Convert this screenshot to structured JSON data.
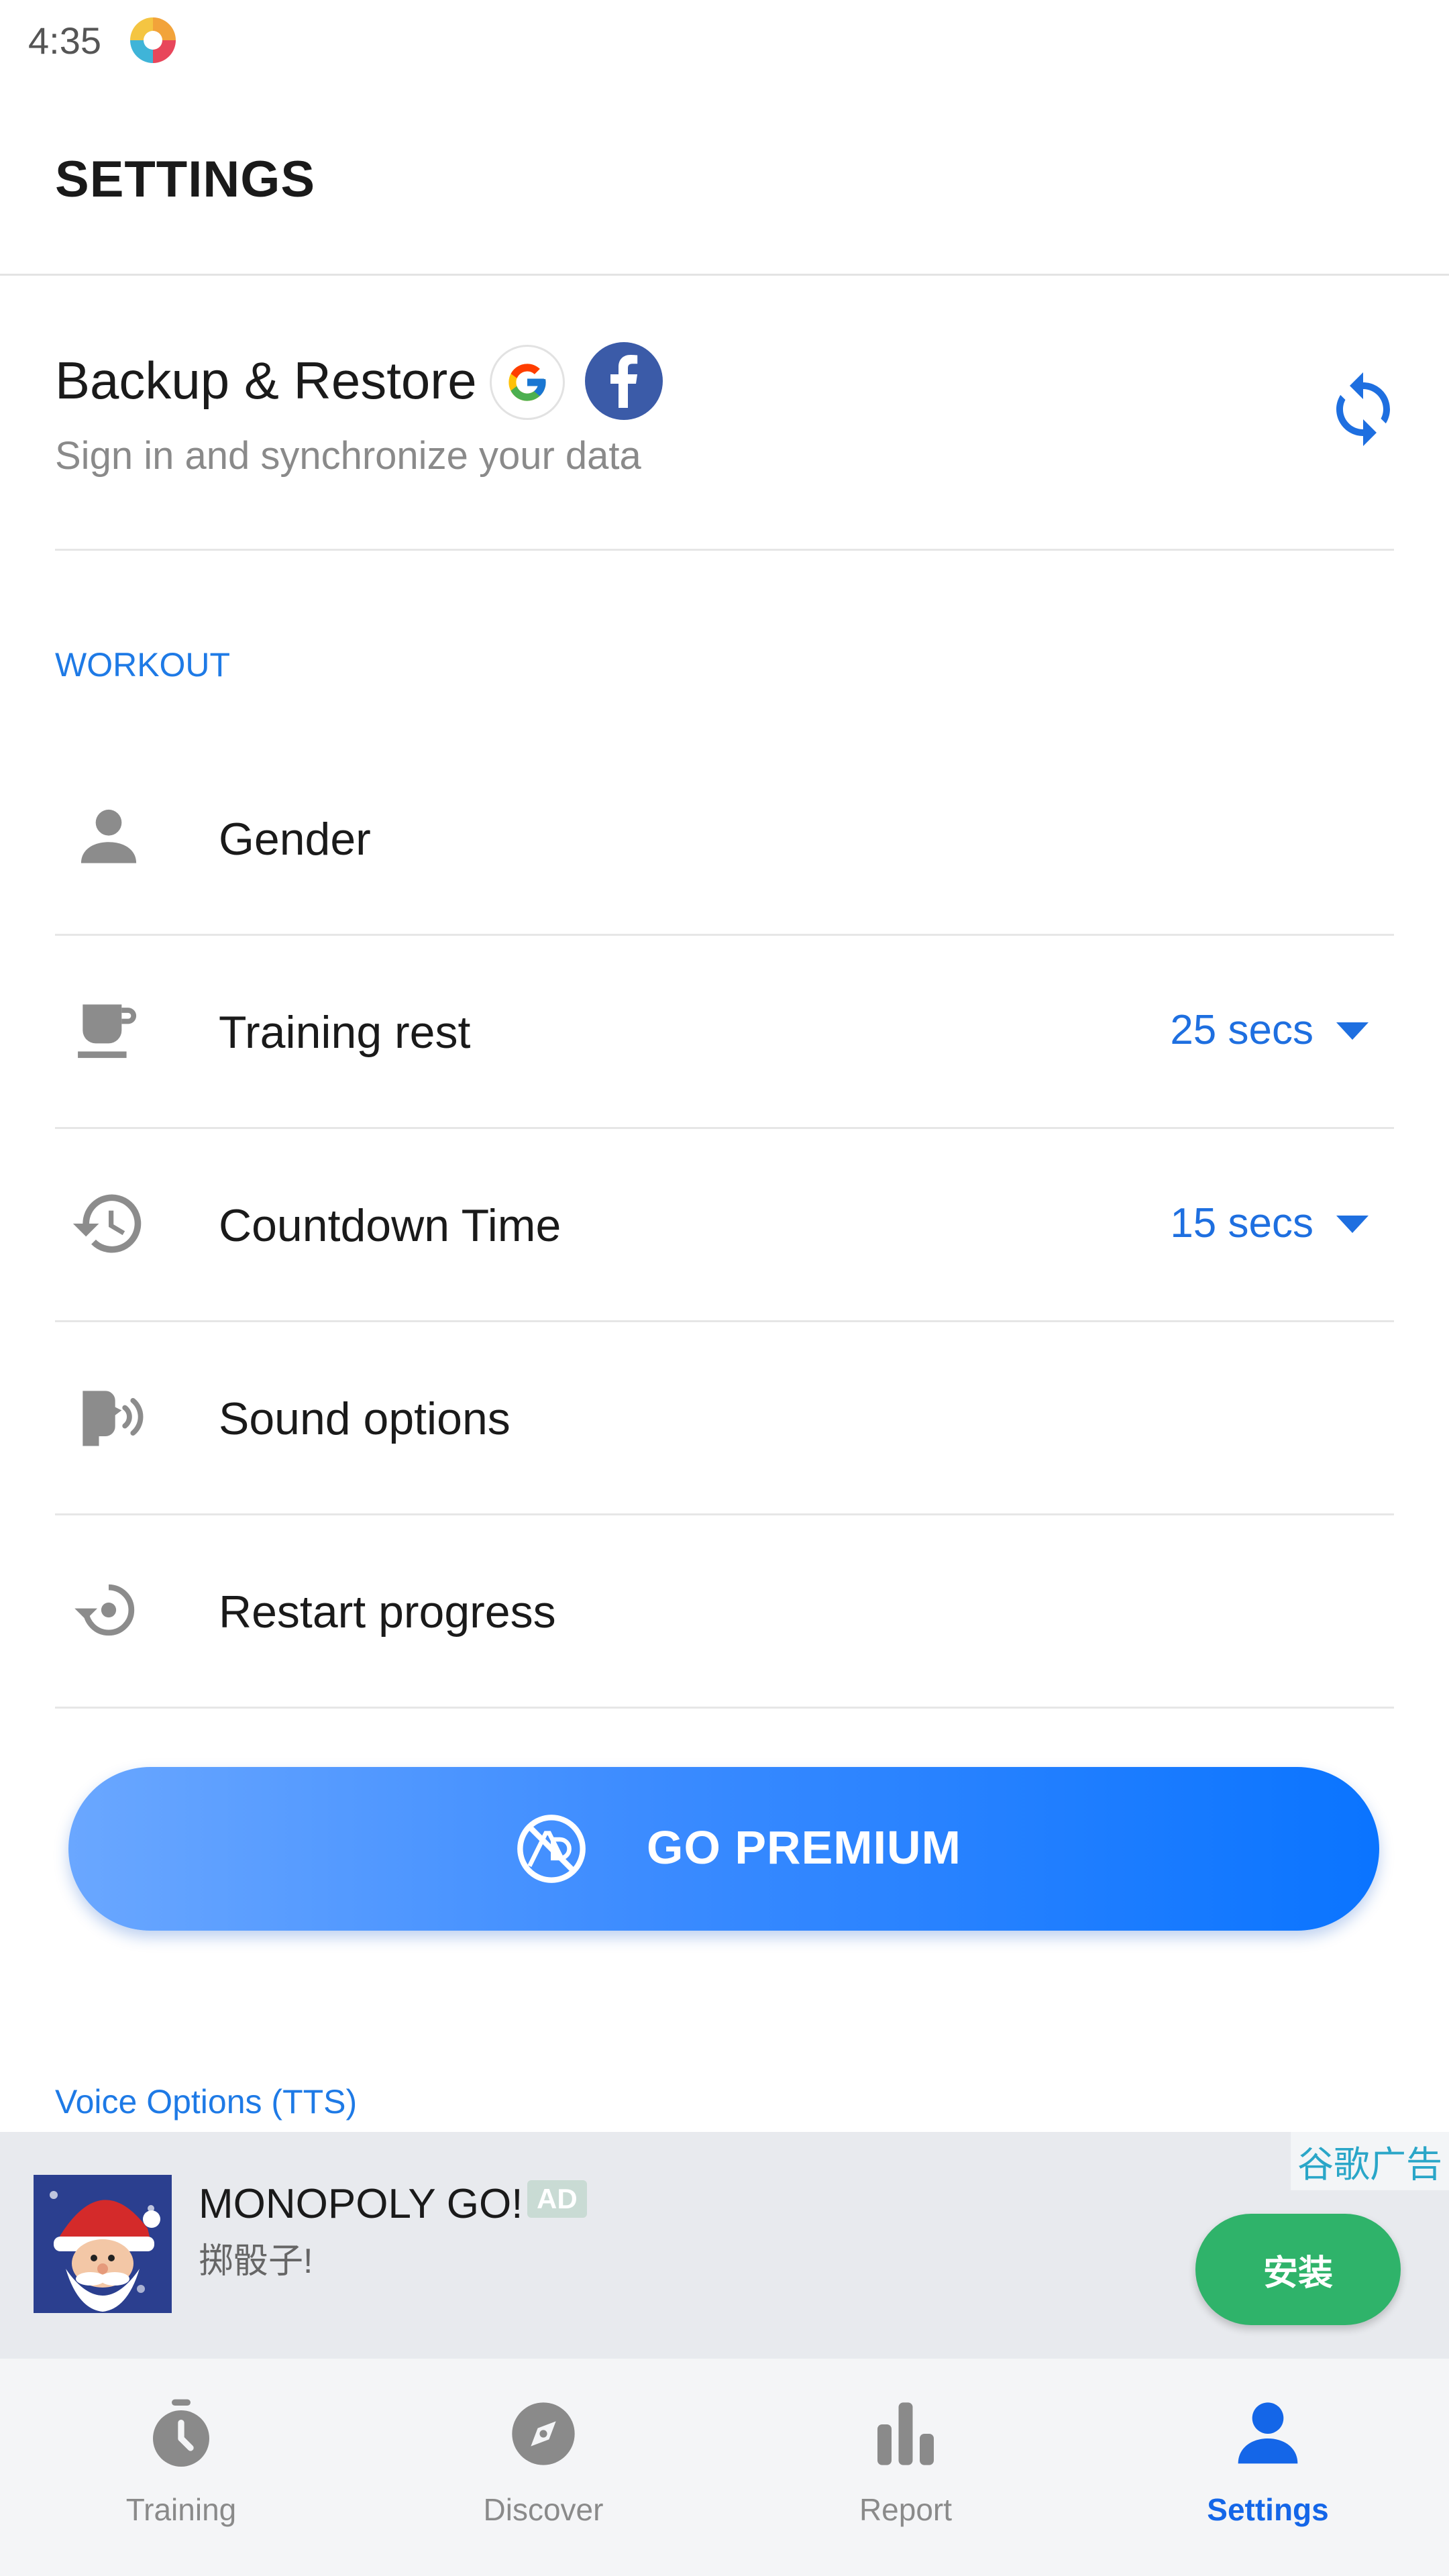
{
  "status_bar": {
    "time": "4:35"
  },
  "header": {
    "title": "SETTINGS"
  },
  "backup": {
    "title": "Backup & Restore",
    "subtitle": "Sign in and synchronize your data"
  },
  "workout": {
    "section_label": "WORKOUT",
    "rows": [
      {
        "label": "Gender",
        "value": "",
        "icon": "person-icon"
      },
      {
        "label": "Training rest",
        "value": "25 secs",
        "icon": "coffee-cup-icon"
      },
      {
        "label": "Countdown Time",
        "value": "15 secs",
        "icon": "history-icon"
      },
      {
        "label": "Sound options",
        "value": "",
        "icon": "voice-icon"
      },
      {
        "label": "Restart progress",
        "value": "",
        "icon": "restart-icon"
      }
    ]
  },
  "premium": {
    "label": "GO PREMIUM"
  },
  "voice_section": {
    "label": "Voice Options (TTS)"
  },
  "ad": {
    "corner_label": "谷歌广告",
    "title": "MONOPOLY GO!",
    "badge": "AD",
    "subtitle": "掷骰子!",
    "install_label": "安装"
  },
  "bottom_nav": {
    "items": [
      {
        "label": "Training",
        "icon": "stopwatch-icon",
        "active": false
      },
      {
        "label": "Discover",
        "icon": "compass-icon",
        "active": false
      },
      {
        "label": "Report",
        "icon": "bar-chart-icon",
        "active": false
      },
      {
        "label": "Settings",
        "icon": "user-icon",
        "active": true
      }
    ]
  },
  "colors": {
    "accent": "#1e6fe0",
    "section_label": "#1e7ae6",
    "install_button": "#2fb36a",
    "premium_gradient_start": "#6aa7ff",
    "premium_gradient_end": "#0a74ff"
  }
}
